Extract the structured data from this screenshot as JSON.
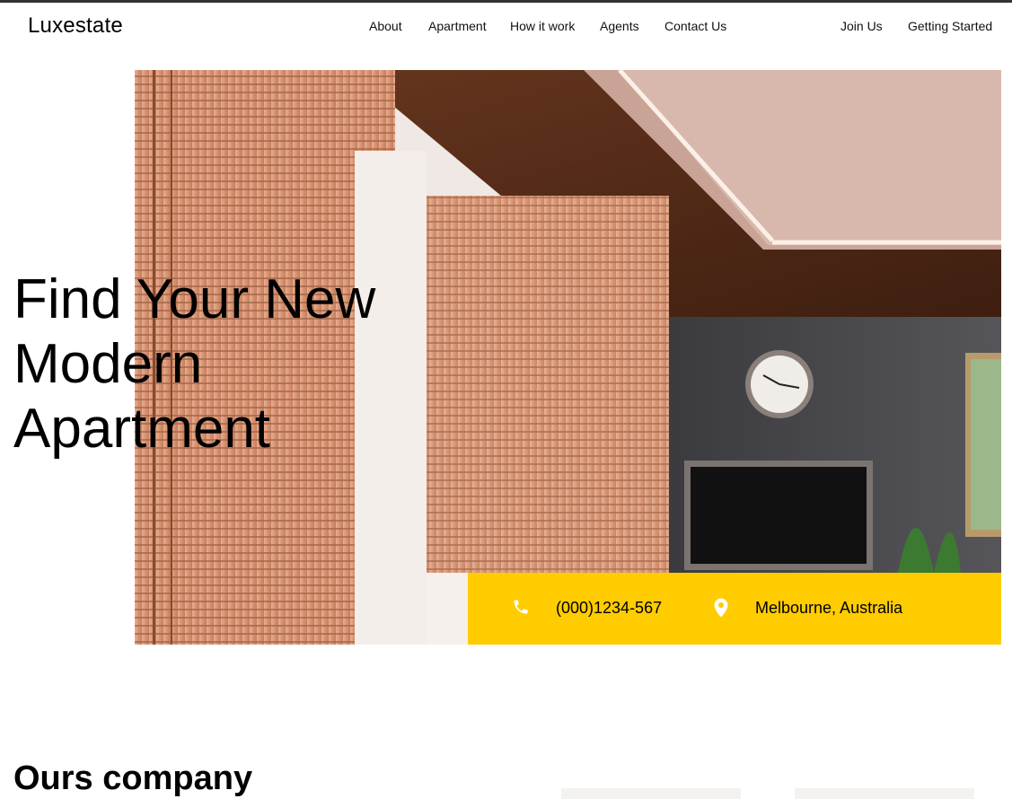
{
  "brand": {
    "name": "Luxestate"
  },
  "nav": {
    "items": [
      "About",
      "Apartment",
      "How it work",
      "Agents",
      "Contact Us"
    ],
    "actions": [
      "Join Us",
      "Getting Started"
    ]
  },
  "hero": {
    "title_lines": [
      "Find Your New",
      "Modern",
      "Apartment"
    ]
  },
  "contact": {
    "phone": "(000)1234-567",
    "location": "Melbourne, Australia",
    "phone_icon": "phone-icon",
    "location_icon": "map-pin-icon",
    "bar_color": "#ffcc00"
  },
  "company": {
    "title": "Ours company"
  }
}
